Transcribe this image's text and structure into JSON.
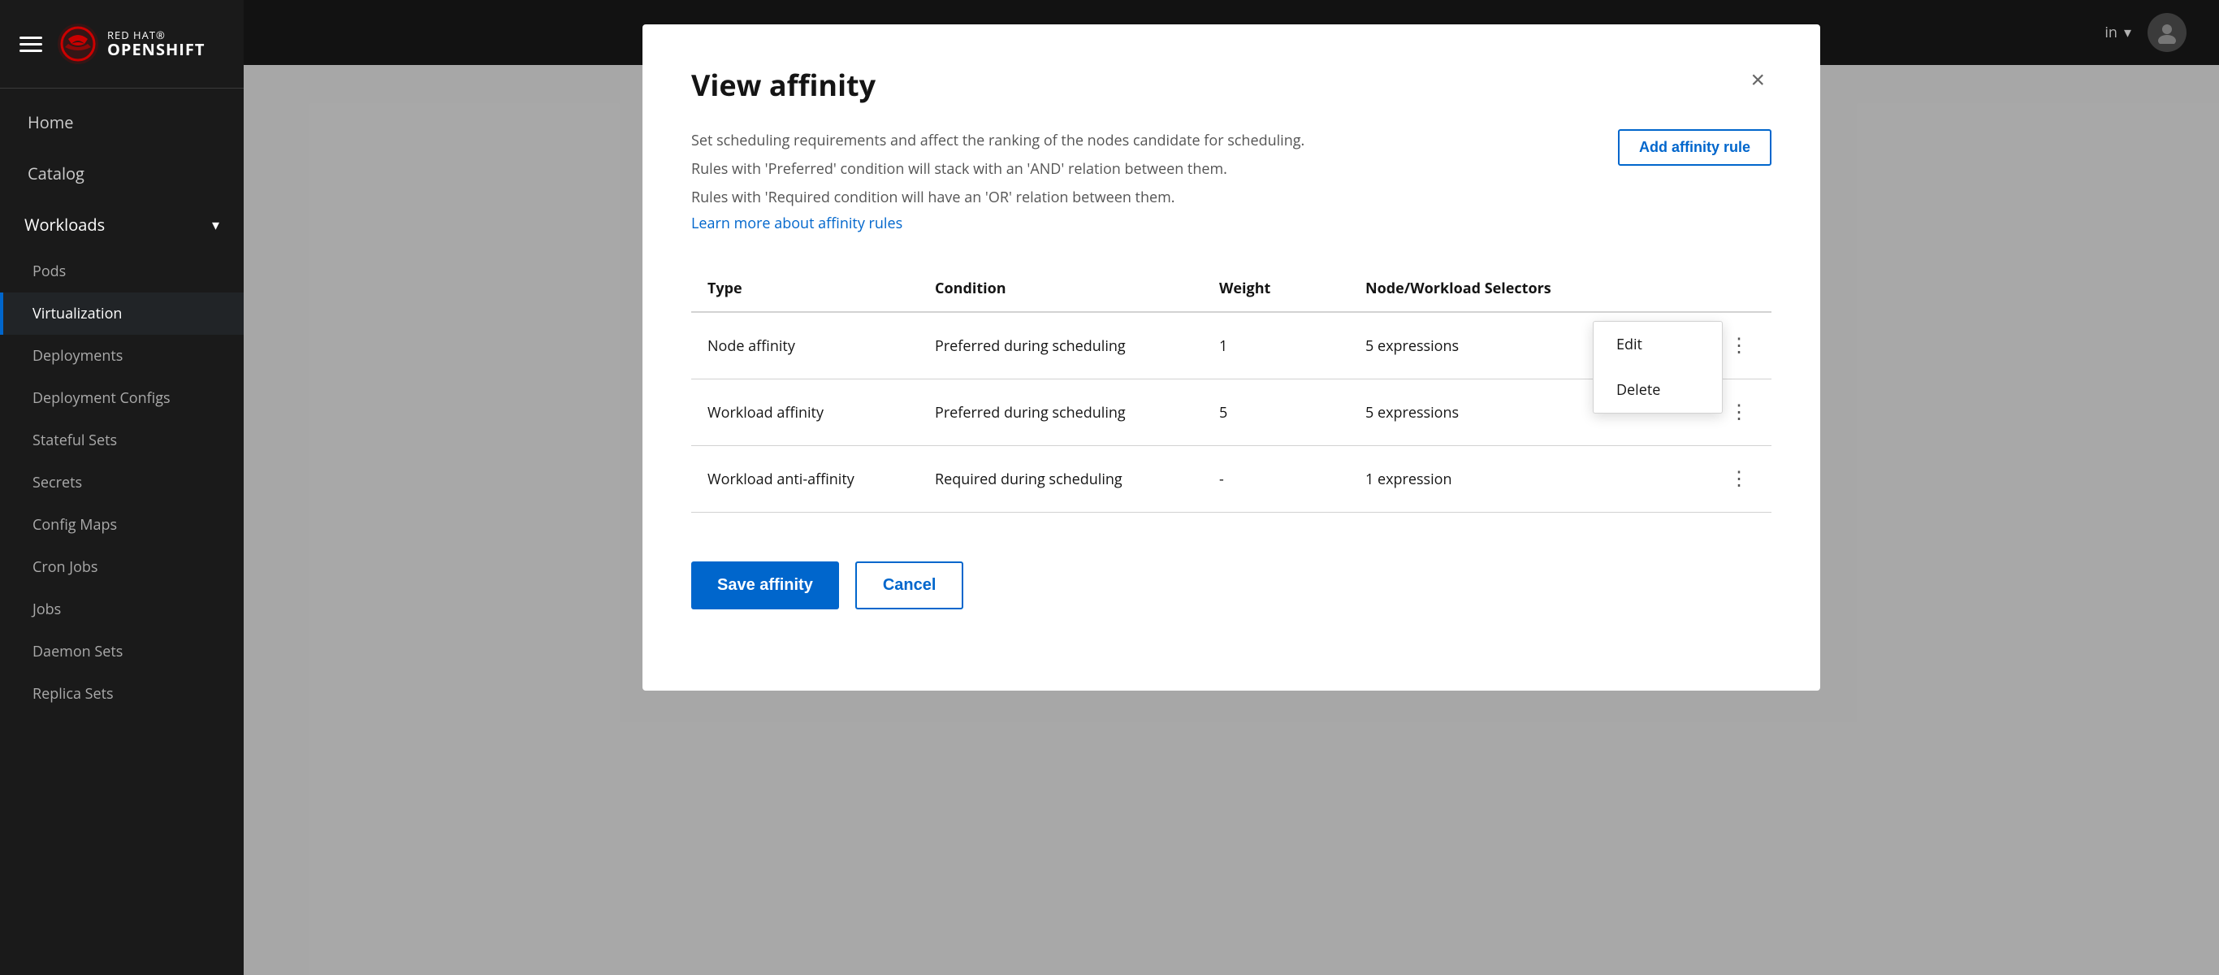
{
  "sidebar": {
    "nav_items": [
      {
        "label": "Home",
        "active": false
      },
      {
        "label": "Catalog",
        "active": false
      }
    ],
    "workloads": {
      "label": "Workloads",
      "expanded": true,
      "sub_items": [
        {
          "label": "Pods",
          "active": false
        },
        {
          "label": "Virtualization",
          "active": true
        },
        {
          "label": "Deployments",
          "active": false
        },
        {
          "label": "Deployment Configs",
          "active": false
        },
        {
          "label": "Stateful Sets",
          "active": false
        },
        {
          "label": "Secrets",
          "active": false
        },
        {
          "label": "Config Maps",
          "active": false
        },
        {
          "label": "Cron Jobs",
          "active": false
        },
        {
          "label": "Jobs",
          "active": false
        },
        {
          "label": "Daemon Sets",
          "active": false
        },
        {
          "label": "Replica Sets",
          "active": false
        }
      ]
    }
  },
  "topbar": {
    "user_label": "in",
    "chevron": "▾"
  },
  "modal": {
    "title": "View affinity",
    "close_label": "×",
    "description_line1": "Set scheduling requirements and affect the ranking of the nodes candidate for scheduling.",
    "description_line2": "Rules with 'Preferred' condition will stack with an 'AND' relation between them.",
    "description_line3": "Rules with 'Required condition will have an 'OR' relation between them.",
    "learn_more_label": "Learn more about affinity rules",
    "add_rule_label": "Add affinity rule",
    "table": {
      "headers": [
        "Type",
        "Condition",
        "Weight",
        "Node/Workload Selectors"
      ],
      "rows": [
        {
          "type": "Node affinity",
          "condition": "Preferred during scheduling",
          "weight": "1",
          "selectors": "5 expressions"
        },
        {
          "type": "Workload affinity",
          "condition": "Preferred during scheduling",
          "weight": "5",
          "selectors": "5 expressions"
        },
        {
          "type": "Workload anti-affinity",
          "condition": "Required during scheduling",
          "weight": "-",
          "selectors": "1 expression"
        }
      ]
    },
    "context_menu": {
      "items": [
        "Edit",
        "Delete"
      ]
    },
    "save_label": "Save affinity",
    "cancel_label": "Cancel"
  }
}
